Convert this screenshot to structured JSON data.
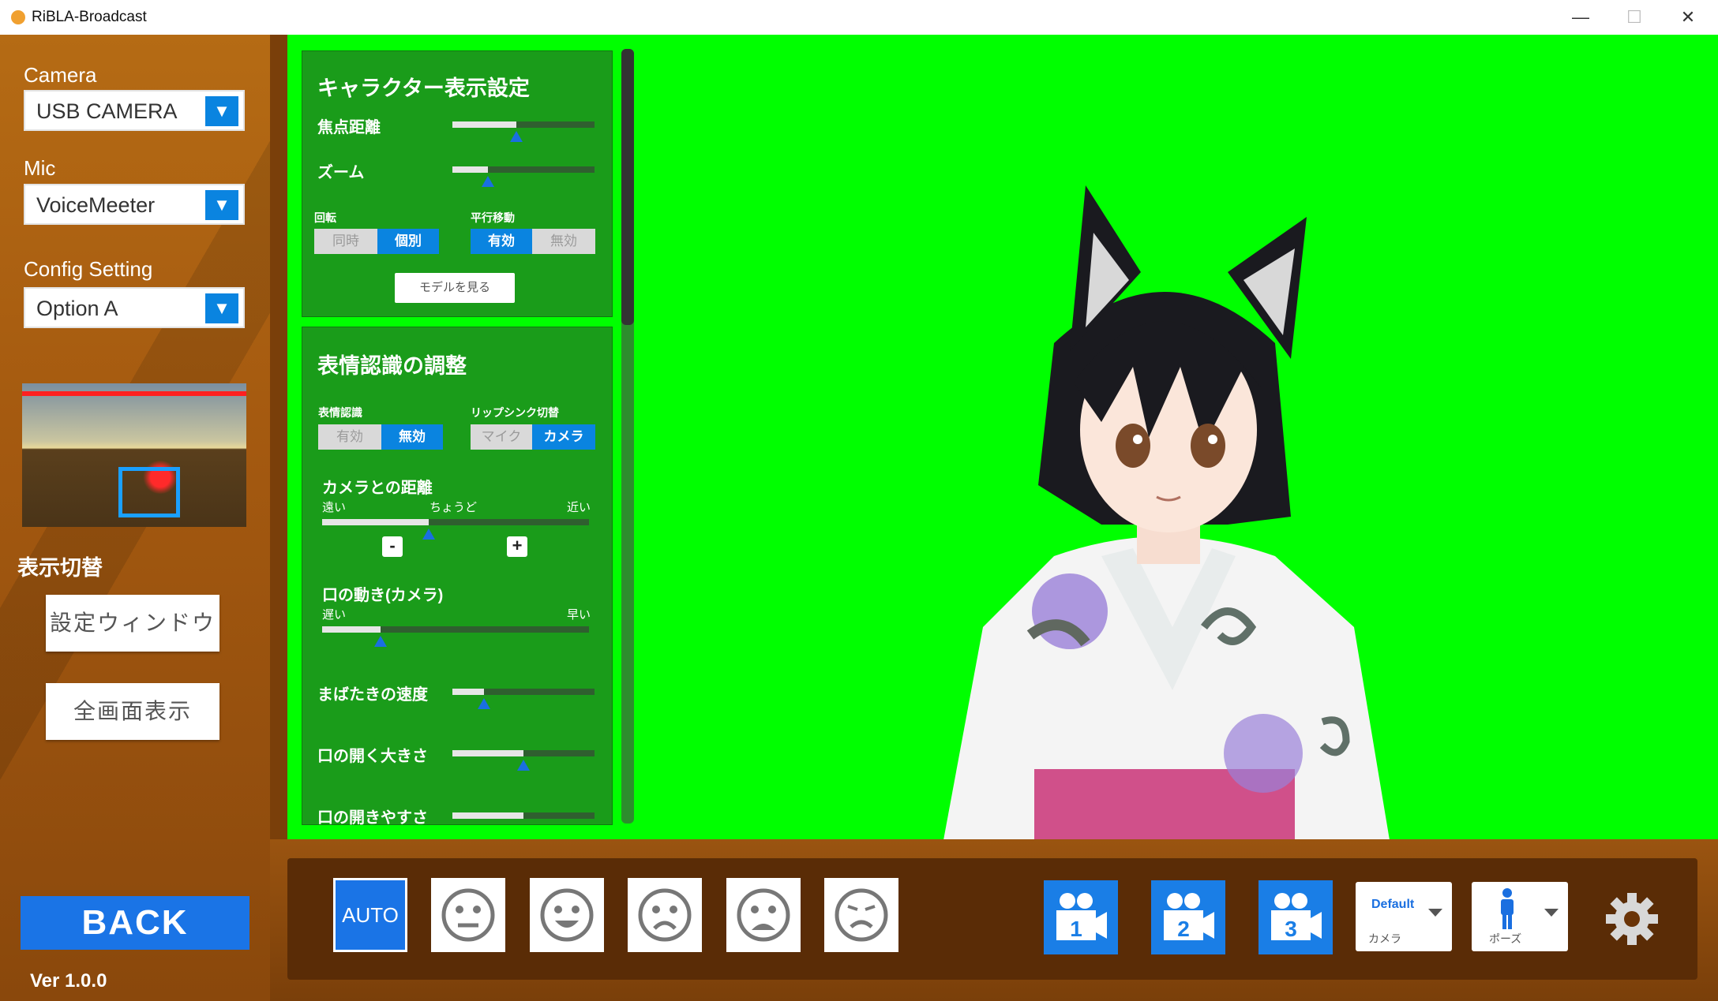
{
  "window": {
    "title": "RiBLA-Broadcast",
    "minimize": "—",
    "maximize": "☐",
    "close": "✕"
  },
  "sidebar": {
    "camera": {
      "label": "Camera",
      "value": "USB CAMERA"
    },
    "mic": {
      "label": "Mic",
      "value": "VoiceMeeter"
    },
    "config": {
      "label": "Config Setting",
      "value": "Option A"
    },
    "toggle_title": "表示切替",
    "settings_window_button": "設定ウィンドウ",
    "fullscreen_button": "全画面表示",
    "back_button": "BACK",
    "version": "Ver 1.0.0",
    "dropdown_arrow": "▼"
  },
  "character_panel": {
    "title": "キャラクター表示設定",
    "focal_label": "焦点距離",
    "focal_value": 0.45,
    "zoom_label": "ズーム",
    "zoom_value": 0.25,
    "rotation_label": "回転",
    "rotation_options": [
      "同時",
      "個別"
    ],
    "rotation_selected": "個別",
    "translate_label": "平行移動",
    "translate_options": [
      "有効",
      "無効"
    ],
    "translate_selected": "有効",
    "view_model_button": "モデルを見る"
  },
  "expression_panel": {
    "title": "表情認識の調整",
    "recognition_label": "表情認識",
    "recognition_options": [
      "有効",
      "無効"
    ],
    "recognition_selected": "無効",
    "lipsync_label": "リップシンク切替",
    "lipsync_options": [
      "マイク",
      "カメラ"
    ],
    "lipsync_selected": "カメラ",
    "distance_label": "カメラとの距離",
    "distance_far": "遠い",
    "distance_mid": "ちょうど",
    "distance_near": "近い",
    "distance_value": 0.4,
    "minus": "-",
    "plus": "+",
    "mouth_label": "口の動き(カメラ)",
    "mouth_slow": "遅い",
    "mouth_fast": "早い",
    "mouth_value": 0.22,
    "blink_label": "まばたきの速度",
    "blink_value": 0.22,
    "mouth_open_label": "口の開く大きさ",
    "mouth_open_value": 0.5,
    "mouth_ease_label": "口の開きやすさ",
    "mouth_ease_value": 0.5
  },
  "bottom_bar": {
    "auto_label": "AUTO",
    "faces": [
      "neutral-face",
      "smile-face",
      "frown-face",
      "sad-face",
      "worried-face"
    ],
    "cameras": [
      "1",
      "2",
      "3"
    ],
    "camera_dropdown": {
      "value": "Default",
      "caption": "カメラ"
    },
    "pose_dropdown": {
      "caption": "ポーズ"
    },
    "colors": {
      "accent": "#1a74e6",
      "stage": "#00ff00",
      "panel": "#1a9c1a"
    }
  }
}
